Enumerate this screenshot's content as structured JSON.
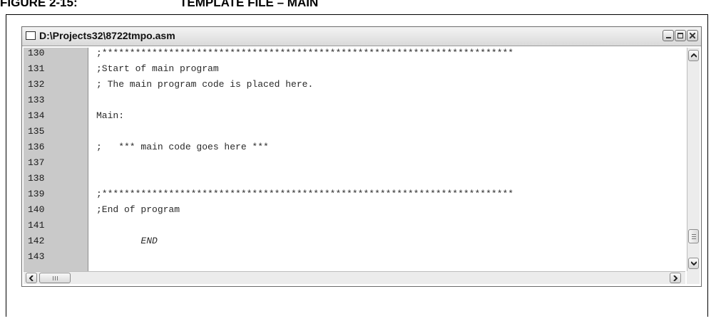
{
  "figure": {
    "label": "FIGURE 2-15:",
    "title": "TEMPLATE FILE – MAIN"
  },
  "window": {
    "title": "D:\\Projects32\\8722tmpo.asm",
    "buttons": [
      "minimize",
      "maximize",
      "close"
    ]
  },
  "editor": {
    "lines": [
      {
        "num": "130",
        "code": ";**************************************************************************",
        "italic": false
      },
      {
        "num": "131",
        "code": ";Start of main program",
        "italic": false
      },
      {
        "num": "132",
        "code": "; The main program code is placed here.",
        "italic": false
      },
      {
        "num": "133",
        "code": "",
        "italic": false
      },
      {
        "num": "134",
        "code": "Main:",
        "italic": false
      },
      {
        "num": "135",
        "code": "",
        "italic": false
      },
      {
        "num": "136",
        "code": ";   *** main code goes here ***",
        "italic": false
      },
      {
        "num": "137",
        "code": "",
        "italic": false
      },
      {
        "num": "138",
        "code": "",
        "italic": false
      },
      {
        "num": "139",
        "code": ";**************************************************************************",
        "italic": false
      },
      {
        "num": "140",
        "code": ";End of program",
        "italic": false
      },
      {
        "num": "141",
        "code": "",
        "italic": false
      },
      {
        "num": "142",
        "code": "        END",
        "italic": true
      },
      {
        "num": "143",
        "code": "",
        "italic": false
      }
    ]
  },
  "icons": {
    "doc": "document-icon",
    "scroll_up": "chevron-up-icon",
    "scroll_down": "chevron-down-icon",
    "scroll_left": "chevron-left-icon",
    "scroll_right": "chevron-right-icon"
  },
  "colors": {
    "gutter": "#c9c9c9",
    "titlebar": "#dcdcdc",
    "text": "#2a2a2a"
  }
}
